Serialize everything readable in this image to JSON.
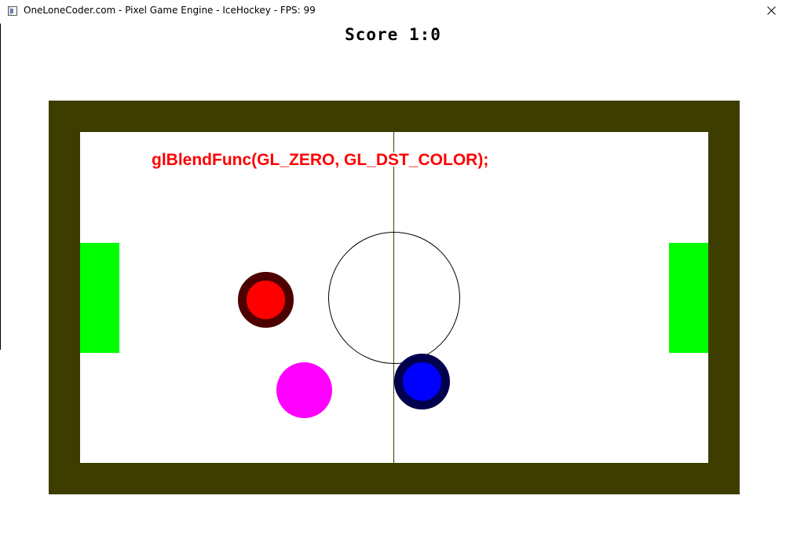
{
  "window": {
    "title": "OneLoneCoder.com - Pixel Game Engine - IceHockey - FPS: 99",
    "close_icon": "close-icon",
    "app_icon": "app-window-icon"
  },
  "game": {
    "score_text": "Score 1:0",
    "score": {
      "left": 1,
      "right": 0
    },
    "overlay_label": "glBlendFunc(GL_ZERO, GL_DST_COLOR);",
    "colors": {
      "rink_border": "#3d3d00",
      "ice": "#ffffff",
      "goal": "#00ff00",
      "paddle_red_fill": "#ff0000",
      "paddle_red_ring": "#4d0000",
      "paddle_blue_fill": "#0000ff",
      "paddle_blue_ring": "#00004d",
      "puck": "#ff00ff",
      "label": "#ff0000"
    }
  }
}
